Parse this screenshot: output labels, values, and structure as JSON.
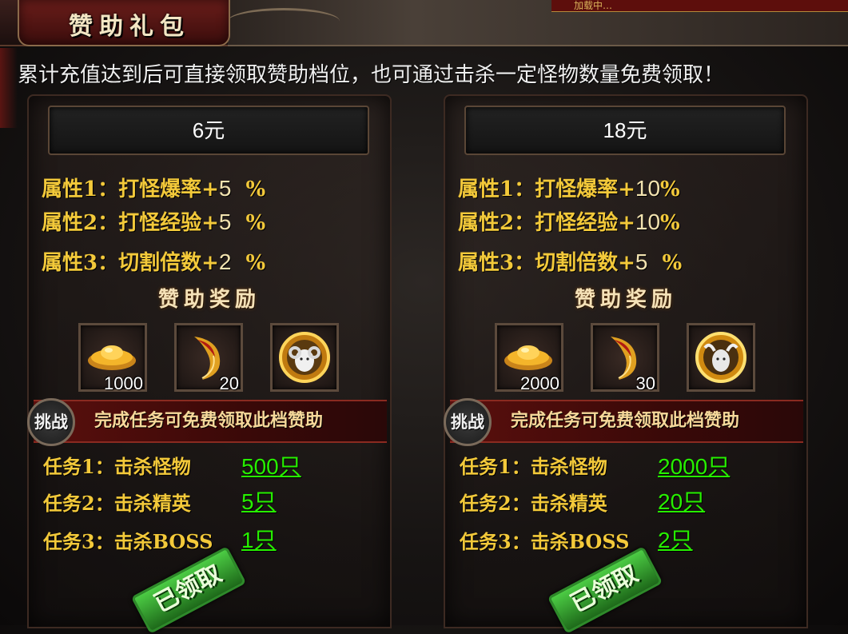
{
  "window": {
    "title": "赞助礼包",
    "ticker": "加载中…"
  },
  "notice": "累计充值达到后可直接领取赞助档位，也可通过击杀一定怪物数量免费领取！",
  "reward_title": "赞助奖励",
  "challenge_badge": "挑战",
  "challenge_text": "完成任务可免费领取此档赞助",
  "stamp_text": "已领取",
  "tiers": [
    {
      "price": "6元",
      "attributes": [
        {
          "label": "属性1：打怪爆率+",
          "value": "5",
          "unit": "%"
        },
        {
          "label": "属性2：打怪经验+",
          "value": "5",
          "unit": "%"
        },
        {
          "label": "属性3：切割倍数+",
          "value": "2",
          "unit": "%"
        }
      ],
      "rewards": [
        {
          "icon": "gold-ingot-icon",
          "count": "1000"
        },
        {
          "icon": "horn-icon",
          "count": "20"
        },
        {
          "icon": "ram-medal-icon",
          "count": ""
        }
      ],
      "tasks": [
        {
          "label": "任务1：击杀怪物",
          "target": "500只"
        },
        {
          "label": "任务2：击杀精英",
          "target": "5只"
        },
        {
          "label": "任务3：击杀BOSS",
          "target": "1只"
        }
      ]
    },
    {
      "price": "18元",
      "attributes": [
        {
          "label": "属性1：打怪爆率+",
          "value": "10",
          "unit": "%"
        },
        {
          "label": "属性2：打怪经验+",
          "value": "10",
          "unit": "%"
        },
        {
          "label": "属性3：切割倍数+",
          "value": "5",
          "unit": "%"
        }
      ],
      "rewards": [
        {
          "icon": "gold-ingot-icon",
          "count": "2000"
        },
        {
          "icon": "horn-icon",
          "count": "30"
        },
        {
          "icon": "ox-medal-icon",
          "count": ""
        }
      ],
      "tasks": [
        {
          "label": "任务1：击杀怪物",
          "target": "2000只"
        },
        {
          "label": "任务2：击杀精英",
          "target": "20只"
        },
        {
          "label": "任务3：击杀BOSS",
          "target": "2只"
        }
      ]
    }
  ],
  "colors": {
    "attr_gold": "#f3c93a",
    "task_link_green": "#27f000",
    "banner_red": "#5a0f0d",
    "stamp_green": "#4ccc44"
  }
}
